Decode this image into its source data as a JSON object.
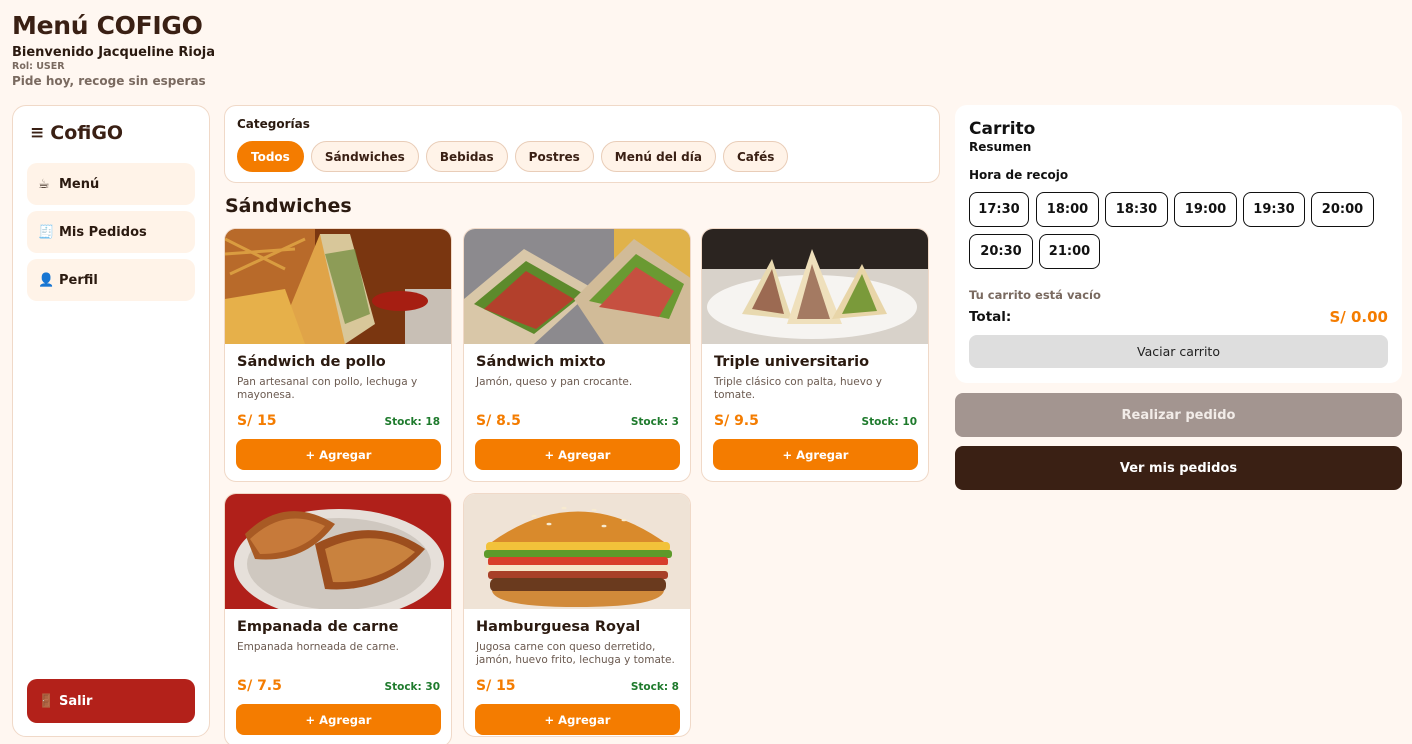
{
  "header": {
    "title": "Menú COFIGO",
    "welcome": "Bienvenido Jacqueline Rioja",
    "role": "Rol: USER",
    "tagline": "Pide hoy, recoge sin esperas"
  },
  "sidebar": {
    "brand_icon": "≡",
    "brand": "CofiGO",
    "items": [
      {
        "icon": "☕",
        "icon_name": "coffee-icon",
        "label": "Menú"
      },
      {
        "icon": "🧾",
        "icon_name": "receipt-icon",
        "label": "Mis Pedidos"
      },
      {
        "icon": "👤",
        "icon_name": "user-icon",
        "label": "Perfil"
      }
    ],
    "logout": {
      "icon": "🚪",
      "icon_name": "door-icon",
      "label": "Salir"
    }
  },
  "categories": {
    "title": "Categorías",
    "items": [
      "Todos",
      "Sándwiches",
      "Bebidas",
      "Postres",
      "Menú del día",
      "Cafés"
    ],
    "active": "Todos"
  },
  "section_title": "Sándwiches",
  "products": [
    {
      "name": "Sándwich de pollo",
      "description": "Pan artesanal con pollo, lechuga y mayonesa.",
      "price": "S/ 15",
      "stock": "Stock: 18",
      "add_label": "+ Agregar"
    },
    {
      "name": "Sándwich mixto",
      "description": "Jamón, queso y pan crocante.",
      "price": "S/ 8.5",
      "stock": "Stock: 3",
      "add_label": "+ Agregar"
    },
    {
      "name": "Triple universitario",
      "description": "Triple clásico con palta, huevo y tomate.",
      "price": "S/ 9.5",
      "stock": "Stock: 10",
      "add_label": "+ Agregar"
    },
    {
      "name": "Empanada de carne",
      "description": "Empanada horneada de carne.",
      "price": "S/ 7.5",
      "stock": "Stock: 30",
      "add_label": "+ Agregar"
    },
    {
      "name": "Hamburguesa Royal",
      "description": "Jugosa carne con queso derretido, jamón, huevo frito, lechuga y tomate.",
      "price": "S/ 15",
      "stock": "Stock: 8",
      "add_label": "+ Agregar"
    }
  ],
  "cart": {
    "title": "Carrito",
    "subtitle": "Resumen",
    "pickup_label": "Hora de recojo",
    "times": [
      "17:30",
      "18:00",
      "18:30",
      "19:00",
      "19:30",
      "20:00",
      "20:30",
      "21:00"
    ],
    "empty_message": "Tu carrito está vacío",
    "total_label": "Total:",
    "total_value": "S/ 0.00",
    "clear_label": "Vaciar carrito"
  },
  "actions": {
    "place_order": "Realizar pedido",
    "my_orders": "Ver mis pedidos"
  },
  "colors": {
    "accent": "#f47c00",
    "dark": "#3a2014",
    "danger": "#b3211a",
    "stock": "#1e7a2c",
    "background": "#fff7f1"
  }
}
